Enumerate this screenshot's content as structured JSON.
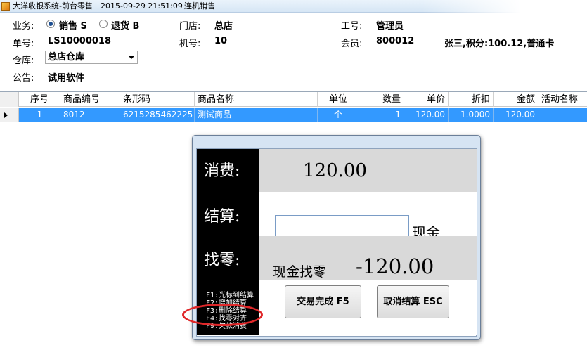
{
  "titlebar": {
    "app_title": "大洋收银系统-前台零售",
    "datetime": "2015-09-29 21:51:09",
    "mode": "连机销售"
  },
  "header": {
    "business_label": "业务:",
    "sale_label": "销售 S",
    "return_label": "退货 B",
    "store_label": "门店:",
    "store_value": "总店",
    "staff_label": "工号:",
    "staff_value": "管理员",
    "order_label": "单号:",
    "order_value": "LS10000018",
    "machine_label": "机号:",
    "machine_value": "10",
    "member_label": "会员:",
    "member_value": "800012",
    "member_info": "张三,积分:100.12,普通卡",
    "warehouse_label": "仓库:",
    "warehouse_value": "总店仓库",
    "notice_label": "公告:",
    "notice_value": "试用软件"
  },
  "grid": {
    "columns": [
      "序号",
      "商品编号",
      "条形码",
      "商品名称",
      "单位",
      "数量",
      "单价",
      "折扣",
      "金额",
      "活动名称"
    ],
    "rows": [
      [
        "1",
        "8012",
        "6215285462225",
        "测试商品",
        "个",
        "1",
        "120.00",
        "1.0000",
        "120.00",
        ""
      ]
    ]
  },
  "dialog": {
    "consume_label": "消费:",
    "consume_value": "120.00",
    "settle_label": "结算:",
    "settle_input": "",
    "settle_method": "现金",
    "change_label": "找零:",
    "change_desc": "现金找零",
    "change_value": "-120.00",
    "hotkeys": [
      "F1:光标到结算",
      "F2:增加结算",
      "F3:删除结算",
      "F4:找零对齐",
      "F9:欠款消费"
    ],
    "confirm_button": "交易完成 F5",
    "cancel_button": "取消结算 ESC"
  },
  "colors": {
    "selected_row": "#3399ff",
    "highlight_circle": "#e0282a"
  }
}
